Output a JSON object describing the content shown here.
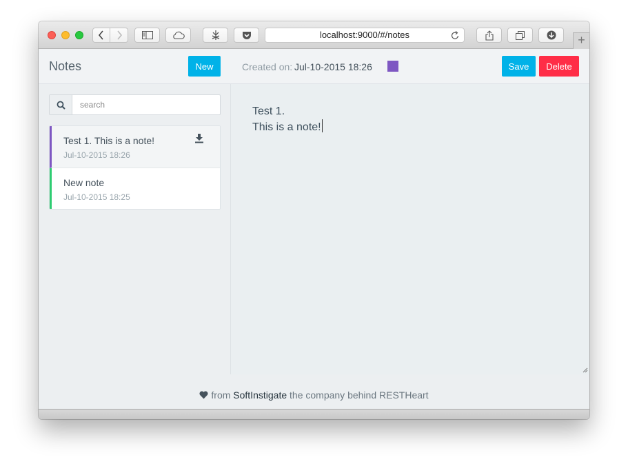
{
  "browser": {
    "url": "localhost:9000/#/notes",
    "icons": [
      "back-icon",
      "forward-icon",
      "sidebar-icon",
      "cloud-icon",
      "extension-icon",
      "pocket-icon",
      "reload-icon",
      "share-icon",
      "tabs-icon",
      "download-icon",
      "new-tab-icon"
    ]
  },
  "sidebar": {
    "title": "Notes",
    "new_label": "New",
    "search": {
      "placeholder": "search",
      "value": ""
    },
    "notes": [
      {
        "title": "Test 1. This is a note!",
        "date": "Jul-10-2015 18:26",
        "color": "#7e57c2"
      },
      {
        "title": "New note",
        "date": "Jul-10-2015 18:25",
        "color": "#2ecc71"
      }
    ]
  },
  "editor": {
    "created_label": "Created on:",
    "created_value": "Jul-10-2015 18:26",
    "swatch_color": "#7e57c2",
    "save_label": "Save",
    "delete_label": "Delete",
    "body": "Test 1.\nThis is a note!"
  },
  "footer": {
    "from": "from",
    "brand": "SoftInstigate",
    "rest": "the company behind RESTHeart"
  },
  "colors": {
    "primary": "#00b2e8",
    "danger": "#ff2d47"
  }
}
